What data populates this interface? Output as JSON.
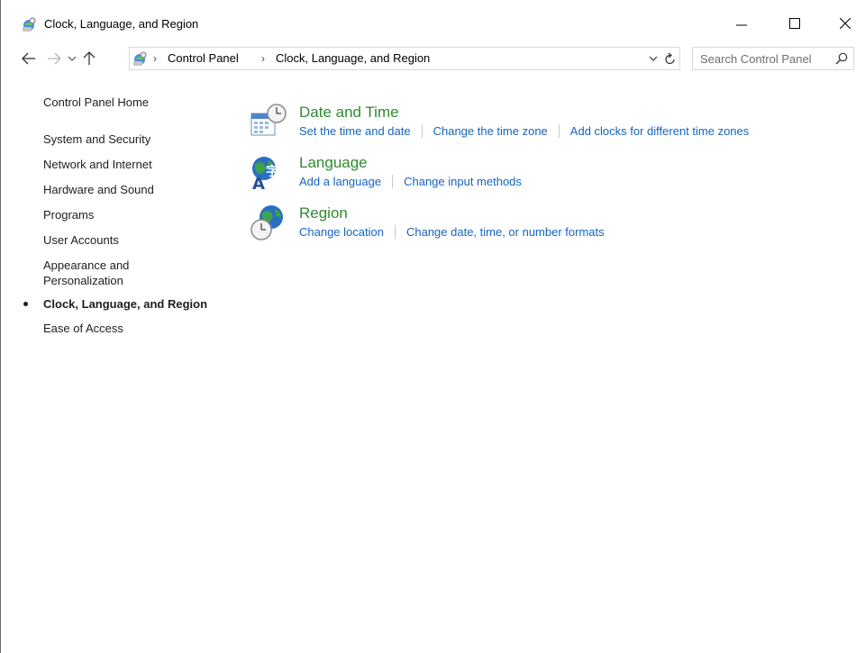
{
  "window": {
    "title": "Clock, Language, and Region",
    "controls": {
      "minimize": "—",
      "maximize": "☐",
      "close": "✕"
    }
  },
  "navigation": {
    "back": "←",
    "forward": "→",
    "recent": "⌄",
    "up": "↑"
  },
  "address": {
    "separator": "›",
    "crumbs": [
      "Control Panel",
      "Clock, Language, and Region"
    ]
  },
  "search": {
    "placeholder": "Search Control Panel"
  },
  "sidebar": {
    "items": [
      {
        "label": "Control Panel Home"
      },
      {
        "label": "System and Security"
      },
      {
        "label": "Network and Internet"
      },
      {
        "label": "Hardware and Sound"
      },
      {
        "label": "Programs"
      },
      {
        "label": "User Accounts"
      },
      {
        "label": "Appearance and Personalization"
      },
      {
        "label": "Clock, Language, and Region",
        "current": true
      },
      {
        "label": "Ease of Access"
      }
    ]
  },
  "categories": [
    {
      "title": "Date and Time",
      "icon": "calendar-clock-icon",
      "links": [
        "Set the time and date",
        "Change the time zone",
        "Add clocks for different time zones"
      ]
    },
    {
      "title": "Language",
      "icon": "language-globe-icon",
      "links": [
        "Add a language",
        "Change input methods"
      ]
    },
    {
      "title": "Region",
      "icon": "globe-clock-icon",
      "links": [
        "Change location",
        "Change date, time, or number formats"
      ]
    }
  ],
  "colors": {
    "category_title": "#2e8b2e",
    "link": "#1565c0",
    "text": "#1e1e1e"
  }
}
